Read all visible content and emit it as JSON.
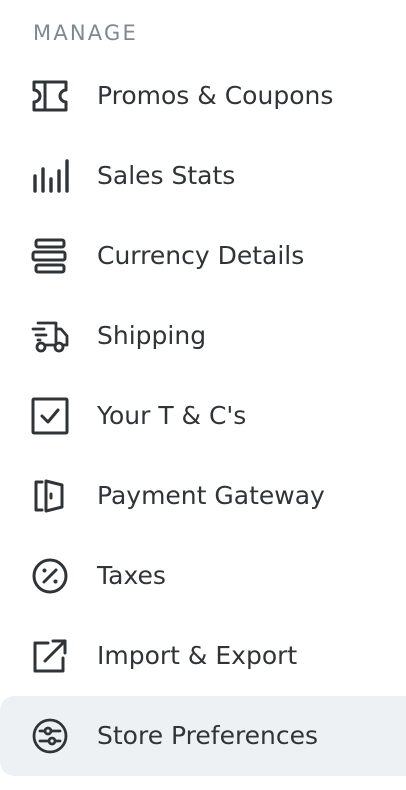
{
  "section": {
    "title": "MANAGE"
  },
  "menu": {
    "items": [
      {
        "label": "Promos & Coupons",
        "icon": "ticket-icon"
      },
      {
        "label": "Sales Stats",
        "icon": "bar-chart-icon"
      },
      {
        "label": "Currency Details",
        "icon": "currency-stack-icon"
      },
      {
        "label": "Shipping",
        "icon": "delivery-truck-icon"
      },
      {
        "label": "Your T & C's",
        "icon": "checkbox-icon"
      },
      {
        "label": "Payment Gateway",
        "icon": "gateway-door-icon"
      },
      {
        "label": "Taxes",
        "icon": "percent-circle-icon"
      },
      {
        "label": "Import & Export",
        "icon": "external-link-icon"
      },
      {
        "label": "Store Preferences",
        "icon": "sliders-circle-icon",
        "active": true
      }
    ]
  },
  "colors": {
    "text": "#2f3438",
    "section_title": "#7d8991",
    "active_background": "#eef1f4"
  }
}
